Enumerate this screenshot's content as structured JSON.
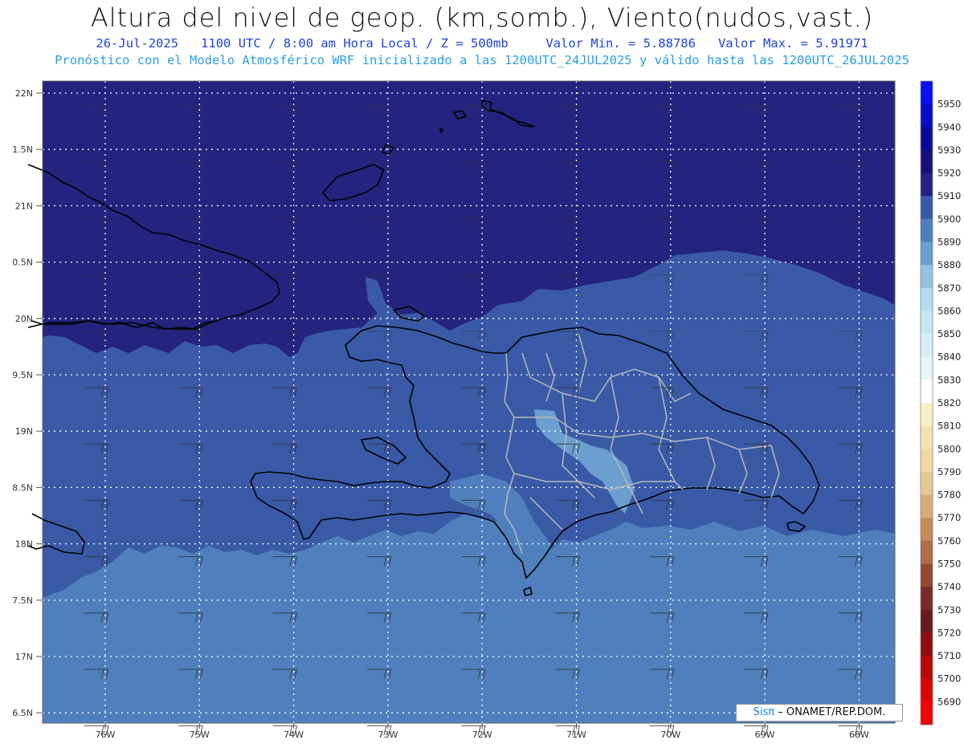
{
  "header": {
    "title": "Altura del nivel de geop. (km,somb.), Viento(nudos,vast.)",
    "date": "26-Jul-2025",
    "time": "1100 UTC / 8:00 am Hora Local / Z = 500mb",
    "min_label": "Valor Min. = 5.88786",
    "max_label": "Valor Max. = 5.91971",
    "subtitle": "Pronóstico con el Modelo Atmosférico WRF inicializado a las 1200UTC_24JUL2025 y válido hasta las  1200UTC_26JUL2025"
  },
  "map": {
    "lat_labels": [
      "22N",
      "1.5N",
      "21N",
      "0.5N",
      "20N",
      "9.5N",
      "19N",
      "8.5N",
      "18N",
      "7.5N",
      "17N",
      "6.5N"
    ],
    "lon_labels": [
      "76W",
      "75W",
      "74W",
      "73W",
      "72W",
      "71W",
      "70W",
      "69W",
      "68W"
    ],
    "colors": {
      "band_5910": "#24237f",
      "band_5900": "#3a5aa8",
      "band_5890": "#4f80bd",
      "band_5880": "#6b9fcf",
      "coast": "#000000",
      "borders": "#b8b8b8",
      "grid": "#ffffff"
    }
  },
  "colorbar": {
    "levels": [
      "5950",
      "5940",
      "5930",
      "5920",
      "5910",
      "5900",
      "5890",
      "5880",
      "5870",
      "5860",
      "5850",
      "5840",
      "5830",
      "5820",
      "5810",
      "5800",
      "5790",
      "5780",
      "5770",
      "5760",
      "5750",
      "5740",
      "5730",
      "5720",
      "5710",
      "5700",
      "5690"
    ],
    "colors": [
      "#0a10f0",
      "#0a0cc8",
      "#0a0a98",
      "#14127a",
      "#24237f",
      "#3a5aa8",
      "#4f80bd",
      "#6b9fcf",
      "#93c2e2",
      "#b4dcef",
      "#c6e6f4",
      "#d6eef8",
      "#e8f6fb",
      "#ffffff",
      "#f9efc5",
      "#f4e3b2",
      "#efd8a4",
      "#e6c690",
      "#d6ab75",
      "#c48a58",
      "#ae6c48",
      "#934834",
      "#7a2a2a",
      "#681a1e",
      "#8e0e10",
      "#b80808",
      "#dd0404",
      "#f60000"
    ]
  },
  "credit": {
    "brand": "Sisπ",
    "org": "– ONAMET/REP.DOM."
  }
}
